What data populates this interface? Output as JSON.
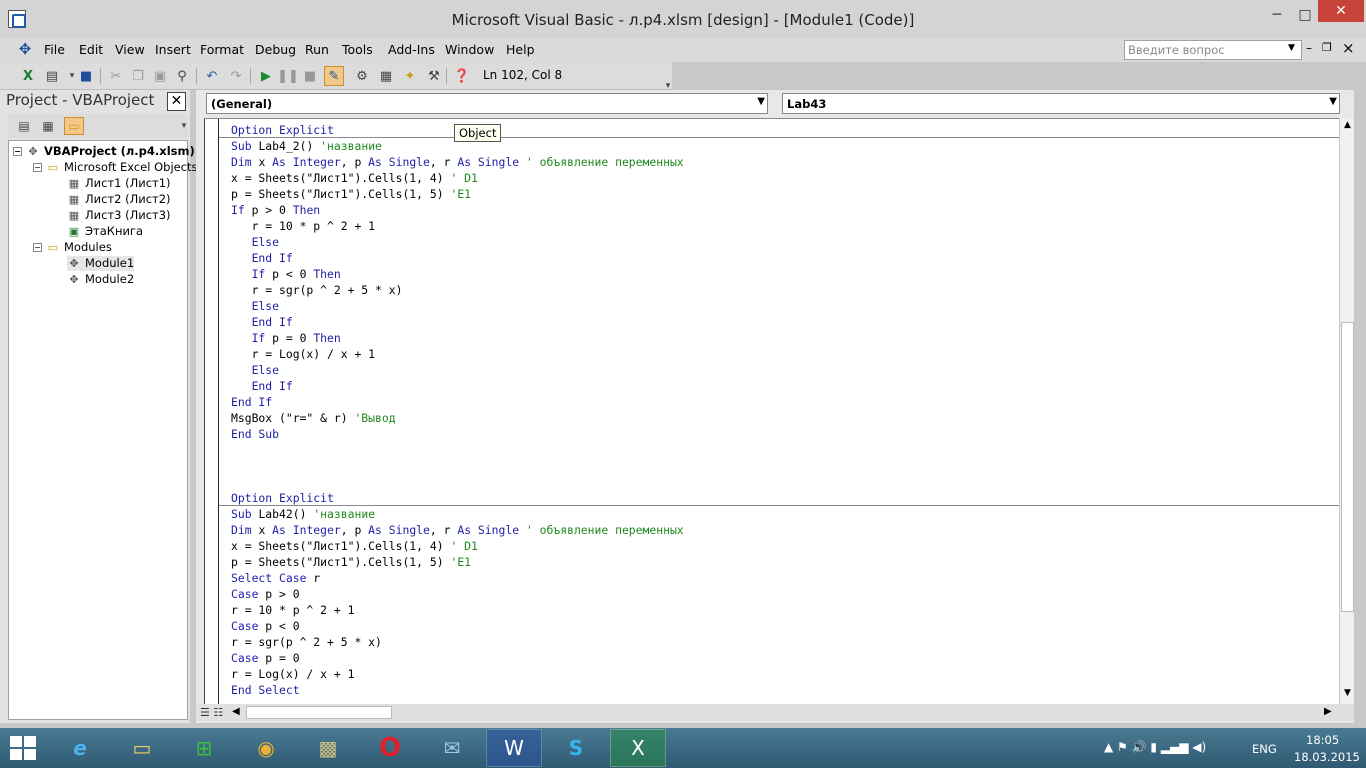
{
  "window": {
    "title": "Microsoft Visual Basic - л.p4.xlsm [design] - [Module1 (Code)]",
    "minimize": "─",
    "maximize": "□",
    "close": "✕"
  },
  "menu": {
    "items": [
      "File",
      "Edit",
      "View",
      "Insert",
      "Format",
      "Debug",
      "Run",
      "Tools",
      "Add-Ins",
      "Window",
      "Help"
    ],
    "help_placeholder": "Введите вопрос",
    "mdi_min": "–",
    "mdi_restore": "❐",
    "mdi_close": "×"
  },
  "toolbar": {
    "status": "Ln 102, Col 8",
    "icons": [
      "excel-icon",
      "insert-userform-icon",
      "save-icon",
      "cut-icon",
      "copy-icon",
      "paste-icon",
      "find-icon",
      "undo-icon",
      "redo-icon",
      "run-icon",
      "break-icon",
      "reset-icon",
      "design-mode-icon",
      "project-explorer-icon",
      "properties-icon",
      "object-browser-icon",
      "toolbox-icon",
      "help-icon"
    ]
  },
  "project": {
    "title": "Project - VBAProject",
    "close": "✕",
    "tree": [
      {
        "label": "VBAProject (л.p4.xlsm)",
        "level": 0,
        "icon": "vba-project-icon",
        "expander": "−",
        "bold": true
      },
      {
        "label": "Microsoft Excel Objects",
        "level": 1,
        "icon": "folder-icon",
        "expander": "−"
      },
      {
        "label": "Лист1 (Лист1)",
        "level": 2,
        "icon": "sheet-icon"
      },
      {
        "label": "Лист2 (Лист2)",
        "level": 2,
        "icon": "sheet-icon"
      },
      {
        "label": "Лист3 (Лист3)",
        "level": 2,
        "icon": "sheet-icon"
      },
      {
        "label": "ЭтаКнига",
        "level": 2,
        "icon": "workbook-icon"
      },
      {
        "label": "Modules",
        "level": 1,
        "icon": "folder-icon",
        "expander": "−"
      },
      {
        "label": "Module1",
        "level": 2,
        "icon": "module-icon",
        "selected": true
      },
      {
        "label": "Module2",
        "level": 2,
        "icon": "module-icon"
      }
    ]
  },
  "code_window": {
    "object_combo": "(General)",
    "procedure_combo": "Lab43",
    "tooltip": "Object",
    "lines": [
      [
        [
          "Option Explicit",
          "kw"
        ]
      ],
      [
        [
          "Sub ",
          "kw"
        ],
        [
          "Lab4_2() ",
          ""
        ],
        [
          "'название",
          "cm"
        ]
      ],
      [
        [
          "Dim ",
          "kw"
        ],
        [
          "x ",
          ""
        ],
        [
          "As Integer",
          "kw"
        ],
        [
          ", p ",
          ""
        ],
        [
          "As Single",
          "kw"
        ],
        [
          ", r ",
          ""
        ],
        [
          "As Single",
          "kw"
        ],
        [
          " ",
          ""
        ],
        [
          "' объявление переменных",
          "cm"
        ]
      ],
      [
        [
          "x = Sheets(\"Лист1\").Cells(1, 4) ",
          ""
        ],
        [
          "' D1",
          "cm"
        ]
      ],
      [
        [
          "p = Sheets(\"Лист1\").Cells(1, 5) ",
          ""
        ],
        [
          "'E1",
          "cm"
        ]
      ],
      [
        [
          "If ",
          "kw"
        ],
        [
          "p > 0 ",
          ""
        ],
        [
          "Then",
          "kw"
        ]
      ],
      [
        [
          "   r = 10 * p ^ 2 + 1",
          ""
        ]
      ],
      [
        [
          "   ",
          ""
        ],
        [
          "Else",
          "kw"
        ]
      ],
      [
        [
          "   ",
          ""
        ],
        [
          "End If",
          "kw"
        ]
      ],
      [
        [
          "   ",
          ""
        ],
        [
          "If ",
          "kw"
        ],
        [
          "p < 0 ",
          ""
        ],
        [
          "Then",
          "kw"
        ]
      ],
      [
        [
          "   r = sgr(p ^ 2 + 5 * x)",
          ""
        ]
      ],
      [
        [
          "   ",
          ""
        ],
        [
          "Else",
          "kw"
        ]
      ],
      [
        [
          "   ",
          ""
        ],
        [
          "End If",
          "kw"
        ]
      ],
      [
        [
          "   ",
          ""
        ],
        [
          "If ",
          "kw"
        ],
        [
          "p = 0 ",
          ""
        ],
        [
          "Then",
          "kw"
        ]
      ],
      [
        [
          "   r = Log(x) / x + 1",
          ""
        ]
      ],
      [
        [
          "   ",
          ""
        ],
        [
          "Else",
          "kw"
        ]
      ],
      [
        [
          "   ",
          ""
        ],
        [
          "End If",
          "kw"
        ]
      ],
      [
        [
          "End If",
          "kw"
        ]
      ],
      [
        [
          "MsgBox (\"r=\" & r) ",
          ""
        ],
        [
          "'Вывод",
          "cm"
        ]
      ],
      [
        [
          "End Sub",
          "kw"
        ]
      ],
      [
        [
          "",
          ""
        ]
      ],
      [
        [
          "",
          ""
        ]
      ],
      [
        [
          "",
          ""
        ]
      ],
      [
        [
          "Option Explicit",
          "kw"
        ]
      ],
      [
        [
          "Sub ",
          "kw"
        ],
        [
          "Lab42() ",
          ""
        ],
        [
          "'название",
          "cm"
        ]
      ],
      [
        [
          "Dim ",
          "kw"
        ],
        [
          "x ",
          ""
        ],
        [
          "As Integer",
          "kw"
        ],
        [
          ", p ",
          ""
        ],
        [
          "As Single",
          "kw"
        ],
        [
          ", r ",
          ""
        ],
        [
          "As Single",
          "kw"
        ],
        [
          " ",
          ""
        ],
        [
          "' объявление переменных",
          "cm"
        ]
      ],
      [
        [
          "x = Sheets(\"Лист1\").Cells(1, 4) ",
          ""
        ],
        [
          "' D1",
          "cm"
        ]
      ],
      [
        [
          "p = Sheets(\"Лист1\").Cells(1, 5) ",
          ""
        ],
        [
          "'E1",
          "cm"
        ]
      ],
      [
        [
          "Select Case ",
          "kw"
        ],
        [
          "r",
          ""
        ]
      ],
      [
        [
          "Case ",
          "kw"
        ],
        [
          "p > 0",
          ""
        ]
      ],
      [
        [
          "r = 10 * p ^ 2 + 1",
          ""
        ]
      ],
      [
        [
          "Case ",
          "kw"
        ],
        [
          "p < 0",
          ""
        ]
      ],
      [
        [
          "r = sgr(p ^ 2 + 5 * x)",
          ""
        ]
      ],
      [
        [
          "Case ",
          "kw"
        ],
        [
          "p = 0",
          ""
        ]
      ],
      [
        [
          "r = Log(x) / x + 1",
          ""
        ]
      ],
      [
        [
          "End Select",
          "kw"
        ]
      ]
    ],
    "colors": {
      "keyword": "#1f1fa6",
      "comment": "#1f8a1f",
      "text": "#000000"
    }
  },
  "taskbar": {
    "apps": [
      "internet-explorer-icon",
      "file-explorer-icon",
      "store-icon",
      "chrome-icon",
      "archive-icon",
      "opera-icon",
      "outlook-icon",
      "word-icon",
      "skype-icon",
      "excel-icon"
    ],
    "active_app": "excel-icon",
    "tray_icons": "▲ ⚑ 🔊 ▮ ▂▄▆ ◀)",
    "language": "ENG",
    "time": "18:05",
    "date": "18.03.2015"
  }
}
